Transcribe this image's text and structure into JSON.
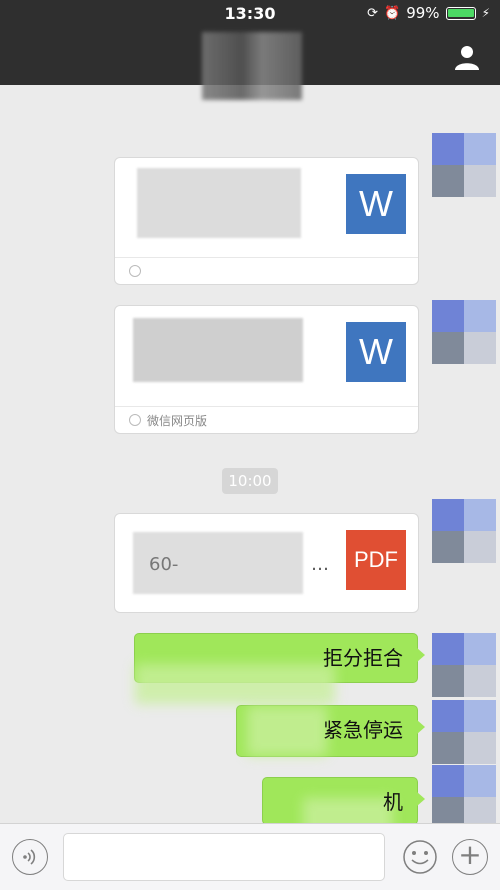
{
  "status_bar": {
    "time": "13:30",
    "battery_percent": "99%",
    "battery_level": 0.99
  },
  "nav": {
    "profile_icon": "person-icon"
  },
  "messages": [
    {
      "type": "file",
      "file_kind": "word",
      "icon_label": "W",
      "source": ""
    },
    {
      "type": "file",
      "file_kind": "word",
      "icon_label": "W",
      "source": "微信网页版"
    },
    {
      "type": "timestamp",
      "text": "10:00"
    },
    {
      "type": "file",
      "file_kind": "pdf",
      "icon_label": "PDF",
      "title_fragment": "60-",
      "ellipsis": "…"
    },
    {
      "type": "text",
      "text": "拒分拒合"
    },
    {
      "type": "text",
      "text": "紧急停运"
    },
    {
      "type": "text",
      "text": "机"
    }
  ],
  "colors": {
    "bar": "#2f2f2f",
    "bubble_green": "#a0e75a",
    "word_blue": "#3f76bf",
    "pdf_red": "#e04f33"
  },
  "input_bar": {
    "voice_icon": "voice-icon",
    "emoji_icon": "emoji-icon",
    "plus_icon": "plus-icon",
    "input_value": ""
  }
}
